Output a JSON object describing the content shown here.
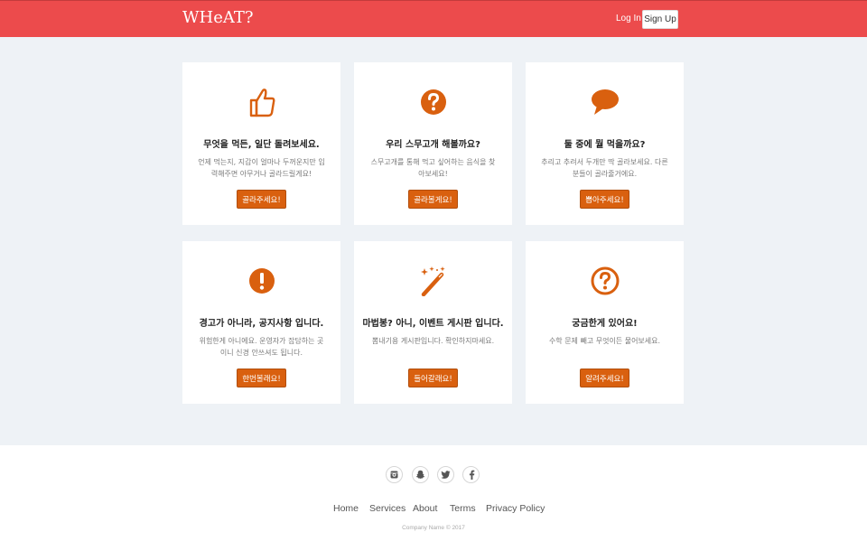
{
  "nav": {
    "brand": "WHeAT?",
    "login_label": "Log In",
    "signup_label": "Sign Up",
    "bg_color": "#ec4b4c"
  },
  "accent_color": "#d9600f",
  "cards": [
    {
      "icon": "thumbs-up-icon",
      "title": "무엇을 먹든, 일단 돌려보세요.",
      "desc": "언제 먹는지, 지갑이 얼마나 두꺼운지만 입력해주면 아무거나 골라드릴게요!",
      "button": "골라주세요!"
    },
    {
      "icon": "question-circle-icon",
      "title": "우리 스무고개 해볼까요?",
      "desc": "스무고개를 통해 먹고 싶어하는 음식을 찾아보세요!",
      "button": "골라볼게요!"
    },
    {
      "icon": "speech-bubble-icon",
      "title": "둘 중에 뭘 먹을까요?",
      "desc": "추리고 추려서 두개만 딱 골라보세요. 다른분들이 골라줄거에요.",
      "button": "뽑아주세요!"
    },
    {
      "icon": "exclamation-circle-icon",
      "title": "경고가 아니라, 공지사항 입니다.",
      "desc": "위험한게 아니에요. 운영자가 잡담하는 곳이니 신경 안쓰셔도 됩니다.",
      "button": "한번볼래요!"
    },
    {
      "icon": "magic-wand-icon",
      "title": "마법봉? 아니, 이벤트 게시판 입니다.",
      "desc": "뽐내기용 게시판입니다. 확인하지마세요.",
      "button": "들어갈래요!"
    },
    {
      "icon": "question-circle-outline-icon",
      "title": "궁금한게 있어요!",
      "desc": "수학 문제 빼고 무엇이든 물어보세요.",
      "button": "알려주세요!"
    }
  ],
  "footer": {
    "social": [
      "instagram-icon",
      "snapchat-icon",
      "twitter-icon",
      "facebook-icon"
    ],
    "links": [
      "Home",
      "Services",
      "About",
      "Terms",
      "Privacy Policy"
    ],
    "copyright": "Company Name © 2017"
  }
}
